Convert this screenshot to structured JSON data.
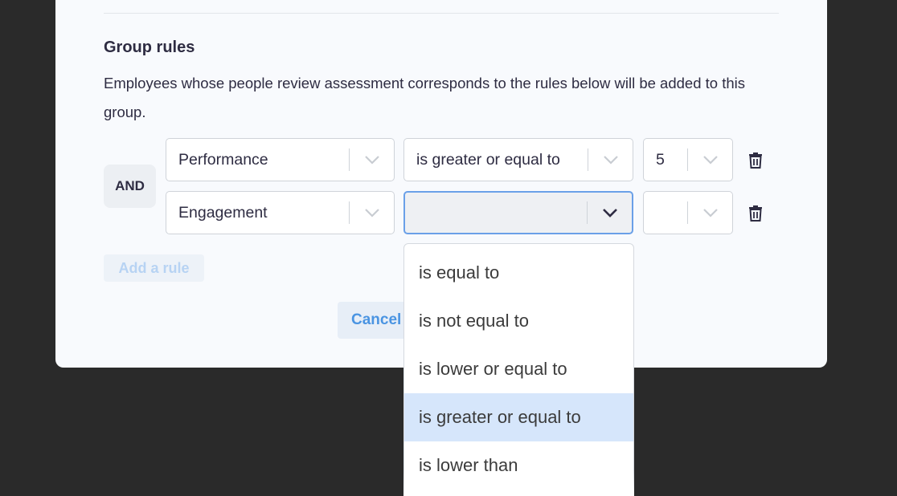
{
  "section": {
    "title": "Group rules",
    "description": "Employees whose people review assessment corresponds to the rules below will be added to this group."
  },
  "operator_label": "AND",
  "rules": [
    {
      "field": "Performance",
      "condition": "is greater or equal to",
      "value": "5"
    },
    {
      "field": "Engagement",
      "condition": "",
      "value": ""
    }
  ],
  "add_rule_label": "Add a rule",
  "cancel_label": "Cancel",
  "dropdown": {
    "options": [
      "is equal to",
      "is not equal to",
      "is lower or equal to",
      "is greater or equal to",
      "is lower than"
    ],
    "highlighted": "is greater or equal to"
  },
  "colors": {
    "accent": "#4a94e2",
    "focus_border": "#6aa0e8",
    "highlight": "#d6e6fb"
  }
}
